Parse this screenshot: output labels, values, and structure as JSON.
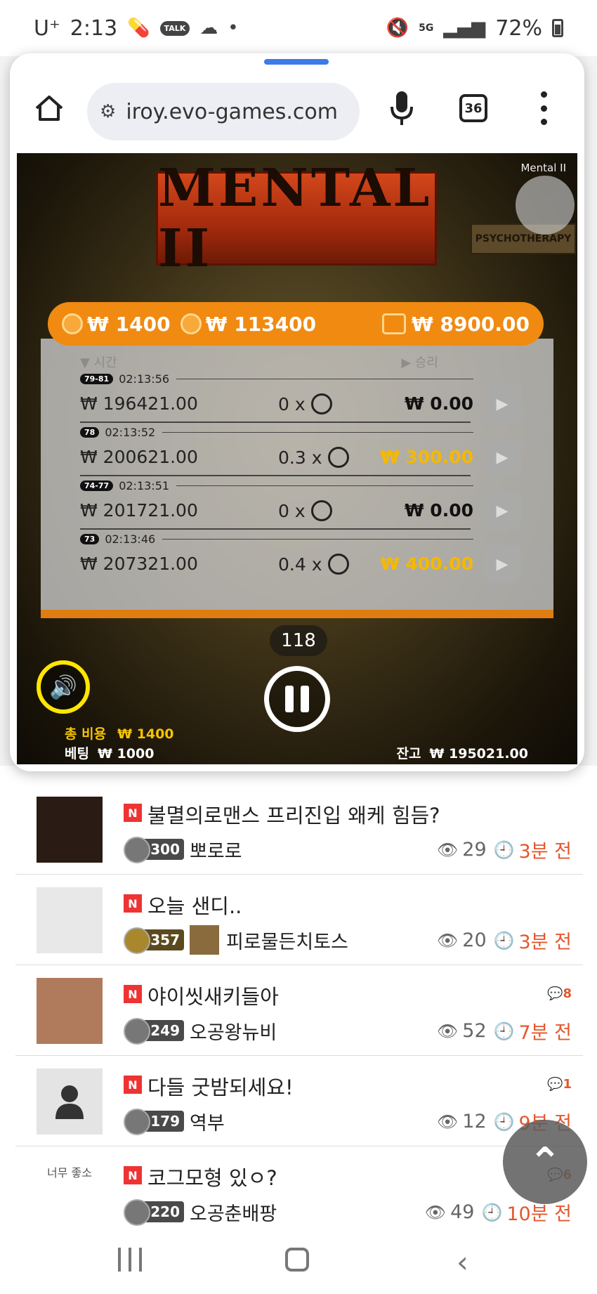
{
  "status_bar": {
    "carrier": "U⁺",
    "time": "2:13",
    "talk_label": "TALK",
    "network": "5G",
    "battery": "72%"
  },
  "browser": {
    "url": "iroy.evo-games.com",
    "tabs_count": "36"
  },
  "game": {
    "name": "Mental II",
    "logo_text": "MENTAL II",
    "sign_text": "PSYCHOTHERAPY",
    "bar": {
      "bet_coin": "₩ 1400",
      "coin_value": "₩ 113400",
      "wallet": "₩ 8900.00"
    },
    "history_headers": {
      "time": "▼ 시간",
      "win": "▶ 승리"
    },
    "history": [
      {
        "badge": "79-81",
        "time": "02:13:56",
        "bet": "₩ 196421.00",
        "mult": "0 x",
        "win": "₩ 0.00",
        "gold": false
      },
      {
        "badge": "78",
        "time": "02:13:52",
        "bet": "₩ 200621.00",
        "mult": "0.3 x",
        "win": "₩ 300.00",
        "gold": true
      },
      {
        "badge": "74-77",
        "time": "02:13:51",
        "bet": "₩ 201721.00",
        "mult": "0 x",
        "win": "₩ 0.00",
        "gold": false
      },
      {
        "badge": "73",
        "time": "02:13:46",
        "bet": "₩ 207321.00",
        "mult": "0.4 x",
        "win": "₩ 400.00",
        "gold": true
      }
    ],
    "round": "118",
    "total_cost_label": "총 비용",
    "total_cost": "₩ 1400",
    "bet_label": "베팅",
    "bet": "₩ 1000",
    "balance_label": "잔고",
    "balance": "₩ 195021.00"
  },
  "posts": [
    {
      "title": "불멸의로맨스 프리진입 왜케 힘듬?",
      "level": "300",
      "author": "뽀로로",
      "views": "29",
      "time": "3분 전",
      "comments": ""
    },
    {
      "title": "오늘 샌디..",
      "level": "357",
      "author": "피로물든치토스",
      "views": "20",
      "time": "3분 전",
      "comments": ""
    },
    {
      "title": "야이씻새키들아",
      "level": "249",
      "author": "오공왕뉴비",
      "views": "52",
      "time": "7분 전",
      "comments": "8"
    },
    {
      "title": "다들 굿밤되세요!",
      "level": "179",
      "author": "역부",
      "views": "12",
      "time": "9분 전",
      "comments": "1"
    },
    {
      "title": "코그모형 있ㅇ?",
      "level": "220",
      "author": "오공춘배팡",
      "views": "49",
      "time": "10분 전",
      "comments": "6"
    }
  ],
  "new_badge": "N",
  "thumb5_text": "너무 좋소",
  "colors": {
    "accent_orange": "#f08a11",
    "time_red": "#e4572e",
    "gold": "#f6b800"
  }
}
